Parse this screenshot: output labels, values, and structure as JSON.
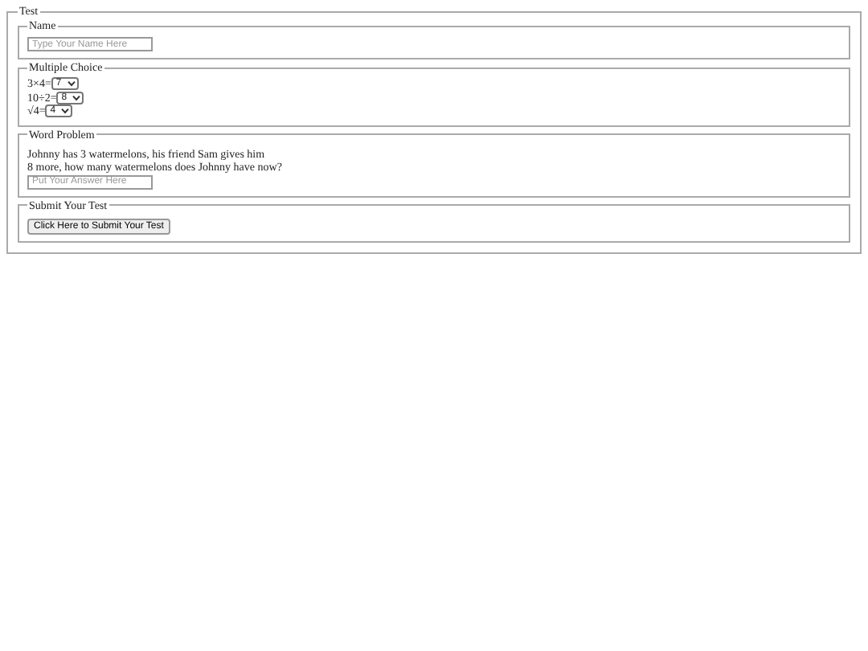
{
  "form": {
    "legend": "Test"
  },
  "sections": [
    {
      "kind": "name",
      "legend": "Name",
      "placeholder": "Type Your Name Here"
    },
    {
      "kind": "choices",
      "legend": "Multiple Choice",
      "questions": [
        {
          "prompt": "3×4=",
          "value": "7"
        },
        {
          "prompt": "10÷2=",
          "value": "8"
        },
        {
          "prompt": "√4=",
          "value": "4"
        }
      ]
    },
    {
      "kind": "problem",
      "legend": "Word Problem",
      "text": "Johnny has 3 watermelons, his friend Sam gives him\n8 more, how many watermelons does Johnny have now?",
      "placeholder": "Put Your Answer Here"
    },
    {
      "kind": "submit",
      "legend": "Submit Your Test",
      "button": "Click Here to Submit Your Test"
    }
  ]
}
